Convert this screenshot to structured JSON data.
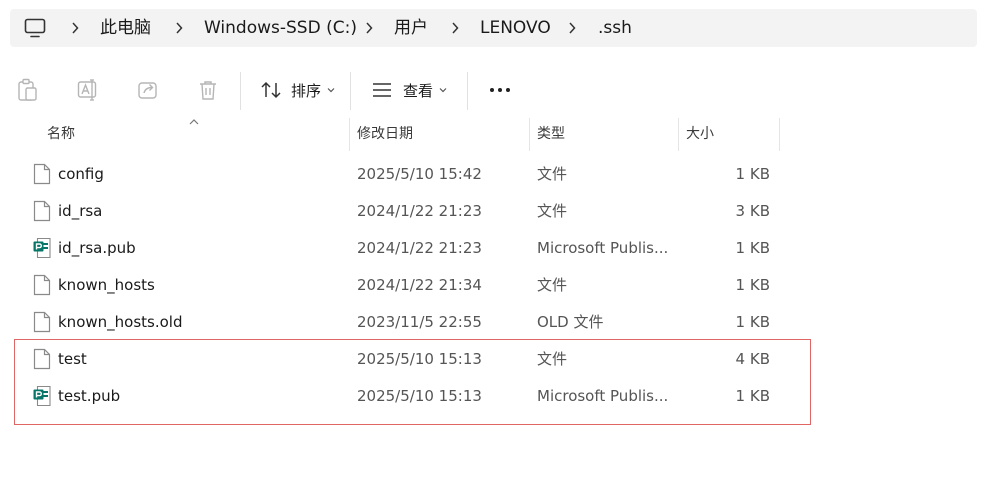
{
  "breadcrumb": {
    "items": [
      "此电脑",
      "Windows-SSD (C:)",
      "用户",
      "LENOVO",
      ".ssh"
    ]
  },
  "toolbar": {
    "sort_label": "排序",
    "view_label": "查看",
    "more_label": "•••"
  },
  "columns": {
    "name": "名称",
    "date": "修改日期",
    "type": "类型",
    "size": "大小"
  },
  "files": [
    {
      "name": "config",
      "date": "2025/5/10 15:42",
      "type": "文件",
      "size": "1 KB",
      "icon": "file-icon"
    },
    {
      "name": "id_rsa",
      "date": "2024/1/22 21:23",
      "type": "文件",
      "size": "3 KB",
      "icon": "file-icon"
    },
    {
      "name": "id_rsa.pub",
      "date": "2024/1/22 21:23",
      "type": "Microsoft Publis...",
      "size": "1 KB",
      "icon": "publisher-icon"
    },
    {
      "name": "known_hosts",
      "date": "2024/1/22 21:34",
      "type": "文件",
      "size": "1 KB",
      "icon": "file-icon"
    },
    {
      "name": "known_hosts.old",
      "date": "2023/11/5 22:55",
      "type": "OLD 文件",
      "size": "1 KB",
      "icon": "file-icon"
    },
    {
      "name": "test",
      "date": "2025/5/10 15:13",
      "type": "文件",
      "size": "4 KB",
      "icon": "file-icon"
    },
    {
      "name": "test.pub",
      "date": "2025/5/10 15:13",
      "type": "Microsoft Publis...",
      "size": "1 KB",
      "icon": "publisher-icon"
    }
  ],
  "colors": {
    "highlight_border": "#e06666",
    "publisher_green": "#077568"
  }
}
